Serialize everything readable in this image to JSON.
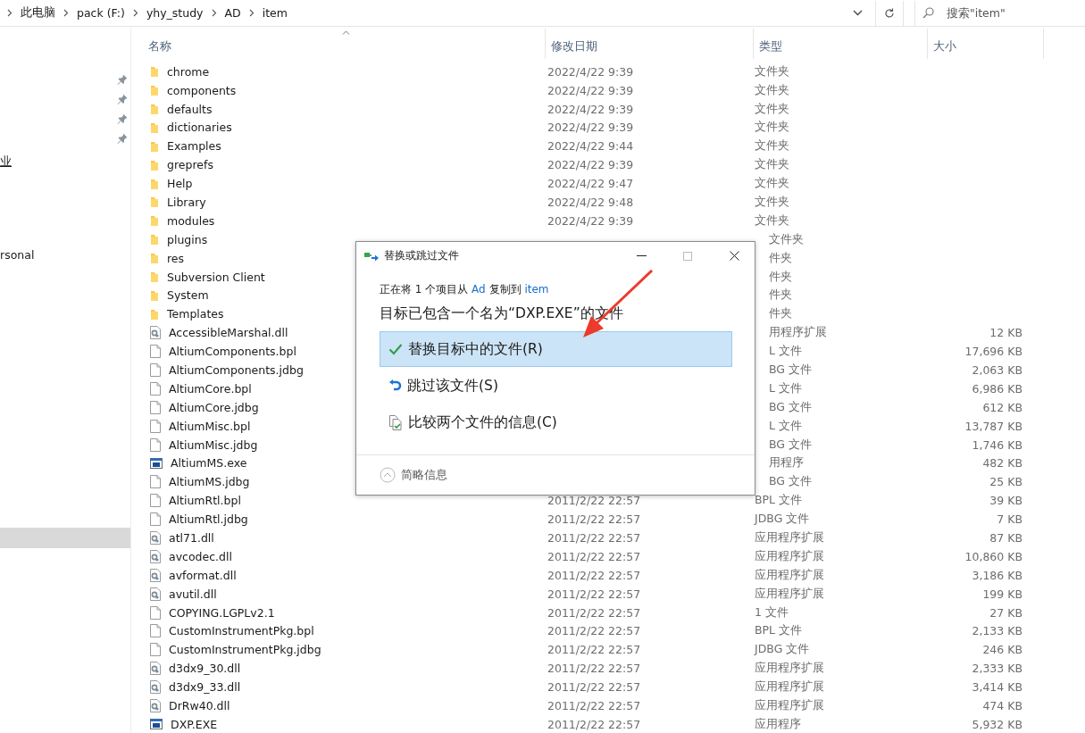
{
  "address_bar": {
    "crumbs": [
      "此电脑",
      "pack (F:)",
      "yhy_study",
      "AD",
      "item"
    ]
  },
  "search": {
    "placeholder": "搜索\"item\""
  },
  "sidebar": {
    "quick_access": [
      {
        "pinned": true
      },
      {
        "pinned": true
      },
      {
        "pinned": true
      },
      {
        "pinned": true
      }
    ],
    "items": [
      {
        "label": "业",
        "selected": false,
        "hovered": true
      },
      {
        "label": "rsonal",
        "selected": false,
        "hovered": false
      },
      {
        "selected": true,
        "hovered": false
      }
    ]
  },
  "table": {
    "columns": [
      {
        "label": "名称",
        "sorted": true
      },
      {
        "label": "修改日期",
        "sorted": false
      },
      {
        "label": "类型",
        "sorted": false
      },
      {
        "label": "大小",
        "sorted": false
      }
    ],
    "rows": [
      {
        "kind": "folder",
        "name": "chrome",
        "date": "2022/4/22 9:39",
        "type": "文件夹"
      },
      {
        "kind": "folder",
        "name": "components",
        "date": "2022/4/22 9:39",
        "type": "文件夹"
      },
      {
        "kind": "folder",
        "name": "defaults",
        "date": "2022/4/22 9:39",
        "type": "文件夹"
      },
      {
        "kind": "folder",
        "name": "dictionaries",
        "date": "2022/4/22 9:39",
        "type": "文件夹"
      },
      {
        "kind": "folder",
        "name": "Examples",
        "date": "2022/4/22 9:44",
        "type": "文件夹"
      },
      {
        "kind": "folder",
        "name": "greprefs",
        "date": "2022/4/22 9:39",
        "type": "文件夹"
      },
      {
        "kind": "folder",
        "name": "Help",
        "date": "2022/4/22 9:47",
        "type": "文件夹"
      },
      {
        "kind": "folder",
        "name": "Library",
        "date": "2022/4/22 9:48",
        "type": "文件夹"
      },
      {
        "kind": "folder",
        "name": "modules",
        "date": "2022/4/22 9:39",
        "type": "文件夹"
      },
      {
        "kind": "folder",
        "name": "plugins",
        "type": "文件夹"
      },
      {
        "kind": "folder",
        "name": "res",
        "type": "件夹"
      },
      {
        "kind": "folder",
        "name": "Subversion Client",
        "type": "件夹"
      },
      {
        "kind": "folder",
        "name": "System",
        "type": "件夹"
      },
      {
        "kind": "folder",
        "name": "Templates",
        "type": "件夹"
      },
      {
        "kind": "dll",
        "name": "AccessibleMarshal.dll",
        "type": "用程序扩展",
        "size": "12 KB"
      },
      {
        "kind": "file",
        "name": "AltiumComponents.bpl",
        "type": "L 文件",
        "size": "17,696 KB"
      },
      {
        "kind": "file",
        "name": "AltiumComponents.jdbg",
        "type": "BG 文件",
        "size": "2,063 KB"
      },
      {
        "kind": "file",
        "name": "AltiumCore.bpl",
        "type": "L 文件",
        "size": "6,986 KB"
      },
      {
        "kind": "file",
        "name": "AltiumCore.jdbg",
        "type": "BG 文件",
        "size": "612 KB"
      },
      {
        "kind": "file",
        "name": "AltiumMisc.bpl",
        "type": "L 文件",
        "size": "13,787 KB"
      },
      {
        "kind": "file",
        "name": "AltiumMisc.jdbg",
        "type": "BG 文件",
        "size": "1,746 KB"
      },
      {
        "kind": "exe",
        "name": "AltiumMS.exe",
        "type": "用程序",
        "size": "482 KB"
      },
      {
        "kind": "file",
        "name": "AltiumMS.jdbg",
        "type": "BG 文件",
        "size": "25 KB"
      },
      {
        "kind": "file",
        "name": "AltiumRtl.bpl",
        "date": "2011/2/22 22:57",
        "type": "BPL 文件",
        "size": "39 KB"
      },
      {
        "kind": "file",
        "name": "AltiumRtl.jdbg",
        "date": "2011/2/22 22:57",
        "type": "JDBG 文件",
        "size": "7 KB"
      },
      {
        "kind": "dll",
        "name": "atl71.dll",
        "date": "2011/2/22 22:57",
        "type": "应用程序扩展",
        "size": "87 KB"
      },
      {
        "kind": "dll",
        "name": "avcodec.dll",
        "date": "2011/2/22 22:57",
        "type": "应用程序扩展",
        "size": "10,860 KB"
      },
      {
        "kind": "dll",
        "name": "avformat.dll",
        "date": "2011/2/22 22:57",
        "type": "应用程序扩展",
        "size": "3,186 KB"
      },
      {
        "kind": "dll",
        "name": "avutil.dll",
        "date": "2011/2/22 22:57",
        "type": "应用程序扩展",
        "size": "199 KB"
      },
      {
        "kind": "file",
        "name": "COPYING.LGPLv2.1",
        "date": "2011/2/22 22:57",
        "type": "1 文件",
        "size": "27 KB"
      },
      {
        "kind": "file",
        "name": "CustomInstrumentPkg.bpl",
        "date": "2011/2/22 22:57",
        "type": "BPL 文件",
        "size": "2,133 KB"
      },
      {
        "kind": "file",
        "name": "CustomInstrumentPkg.jdbg",
        "date": "2011/2/22 22:57",
        "type": "JDBG 文件",
        "size": "246 KB"
      },
      {
        "kind": "dll",
        "name": "d3dx9_30.dll",
        "date": "2011/2/22 22:57",
        "type": "应用程序扩展",
        "size": "2,333 KB"
      },
      {
        "kind": "dll",
        "name": "d3dx9_33.dll",
        "date": "2011/2/22 22:57",
        "type": "应用程序扩展",
        "size": "3,414 KB"
      },
      {
        "kind": "dll",
        "name": "DrRw40.dll",
        "date": "2011/2/22 22:57",
        "type": "应用程序扩展",
        "size": "474 KB"
      },
      {
        "kind": "exe",
        "name": "DXP.EXE",
        "date": "2011/2/22 22:57",
        "type": "应用程序",
        "size": "5,932 KB"
      }
    ]
  },
  "dialog": {
    "title": "替换或跳过文件",
    "status": {
      "prefix": "正在将 1 个项目从",
      "source": "Ad",
      "middle": "复制到",
      "destination": "item"
    },
    "heading": "目标已包含一个名为“DXP.EXE”的文件",
    "options": [
      {
        "kind": "replace",
        "label": "替换目标中的文件(R)",
        "selected": true
      },
      {
        "kind": "skip",
        "label": "跳过该文件(S)",
        "selected": false
      },
      {
        "kind": "compare",
        "label": "比较两个文件的信息(C)",
        "selected": false
      }
    ],
    "details_toggle": "简略信息"
  }
}
